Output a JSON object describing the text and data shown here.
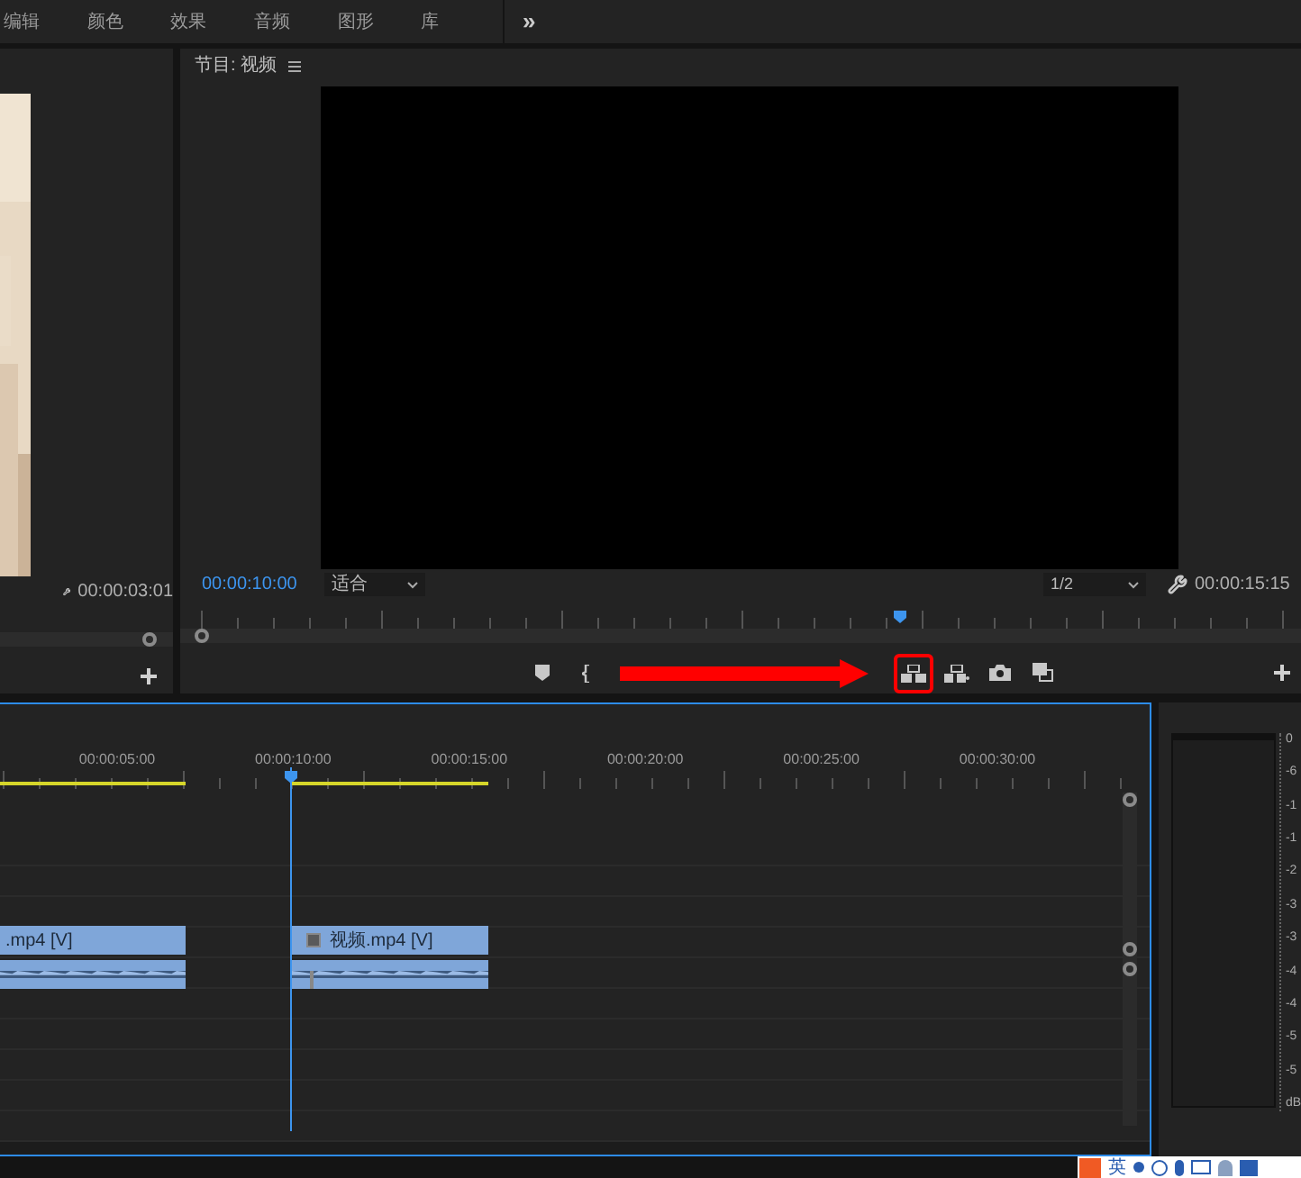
{
  "tabs": [
    {
      "label": "编辑",
      "selected": false
    },
    {
      "label": "颜色",
      "selected": false
    },
    {
      "label": "效果",
      "selected": false
    },
    {
      "label": "音频",
      "selected": false
    },
    {
      "label": "图形",
      "selected": false
    },
    {
      "label": "库",
      "selected": false
    }
  ],
  "overflow": "»",
  "source": {
    "timecode": "00:00:03:01"
  },
  "program": {
    "title": "节目: 视频",
    "timecode": "00:00:10:00",
    "zoom": "适合",
    "resolution": "1/2",
    "duration": "00:00:15:15"
  },
  "controls": [
    {
      "kind": "marker",
      "highlighted": false
    },
    {
      "kind": "mark-in",
      "highlighted": false
    },
    {
      "kind": "lift",
      "highlighted": true
    },
    {
      "kind": "extract",
      "highlighted": false
    },
    {
      "kind": "camera",
      "highlighted": false
    },
    {
      "kind": "compare",
      "highlighted": false
    }
  ],
  "annotation_arrow": true,
  "timeline": {
    "ruler": [
      "00:00:05:00",
      "00:00:10:00",
      "00:00:15:00",
      "00:00:20:00",
      "00:00:25:00",
      "00:00:30:00"
    ],
    "clips": [
      {
        "kind": "video",
        "label": ".mp4 [V]",
        "fx": false
      },
      {
        "kind": "video",
        "label": "视频.mp4 [V]",
        "fx": true
      },
      {
        "kind": "audio",
        "fx": false
      },
      {
        "kind": "audio",
        "fx": true
      }
    ]
  },
  "meter": {
    "scale": [
      "0",
      "-6",
      "-1",
      "-1",
      "-2",
      "-3",
      "-3",
      "-4",
      "-4",
      "-5",
      "-5",
      "dB"
    ]
  },
  "ime": {
    "mode": "英"
  }
}
